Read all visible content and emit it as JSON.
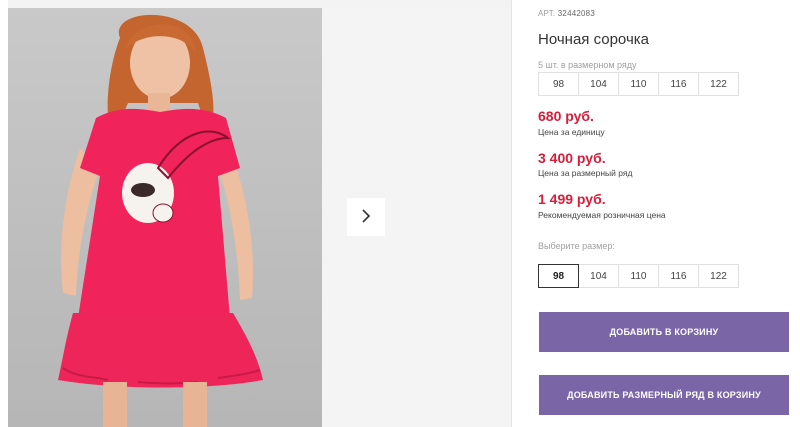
{
  "product": {
    "art_label": "АРТ.",
    "art_number": "32442083",
    "title": "Ночная сорочка"
  },
  "size_range": {
    "label": "5 шт. в размерном ряду",
    "sizes": [
      "98",
      "104",
      "110",
      "116",
      "122"
    ]
  },
  "prices": [
    {
      "value": "680 руб.",
      "note": "Цена за единицу"
    },
    {
      "value": "3 400 руб.",
      "note": "Цена за размерный ряд"
    },
    {
      "value": "1 499 руб.",
      "note": "Рекомендуемая розничная цена"
    }
  ],
  "size_select": {
    "label": "Выберите размер:",
    "sizes": [
      "98",
      "104",
      "110",
      "116",
      "122"
    ],
    "selected": "98"
  },
  "buttons": {
    "add_to_cart": "Добавить в корзину",
    "add_range_to_cart": "Добавить размерный ряд в корзину"
  },
  "gallery": {
    "next_icon": "chevron-right-icon"
  },
  "colors": {
    "price": "#d61d3a",
    "button": "#7a65a6",
    "dress": "#f0245a"
  }
}
